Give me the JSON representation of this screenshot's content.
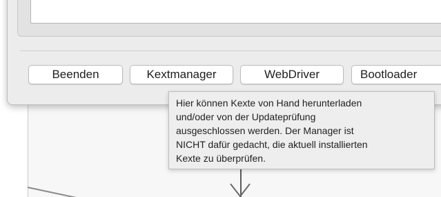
{
  "buttons": {
    "quit_label": "Beenden",
    "kextmanager_label": "Kextmanager",
    "webdriver_label": "WebDriver",
    "bootloader_label": "Bootloader"
  },
  "tooltip": {
    "text": "Hier können Kexte von Hand herunterladen\nund/oder von der Updateprüfung\nausgeschlossen werden. Der Manager ist\nNICHT dafür gedacht, die aktuell installierten\nKexte zu überprüfen."
  }
}
